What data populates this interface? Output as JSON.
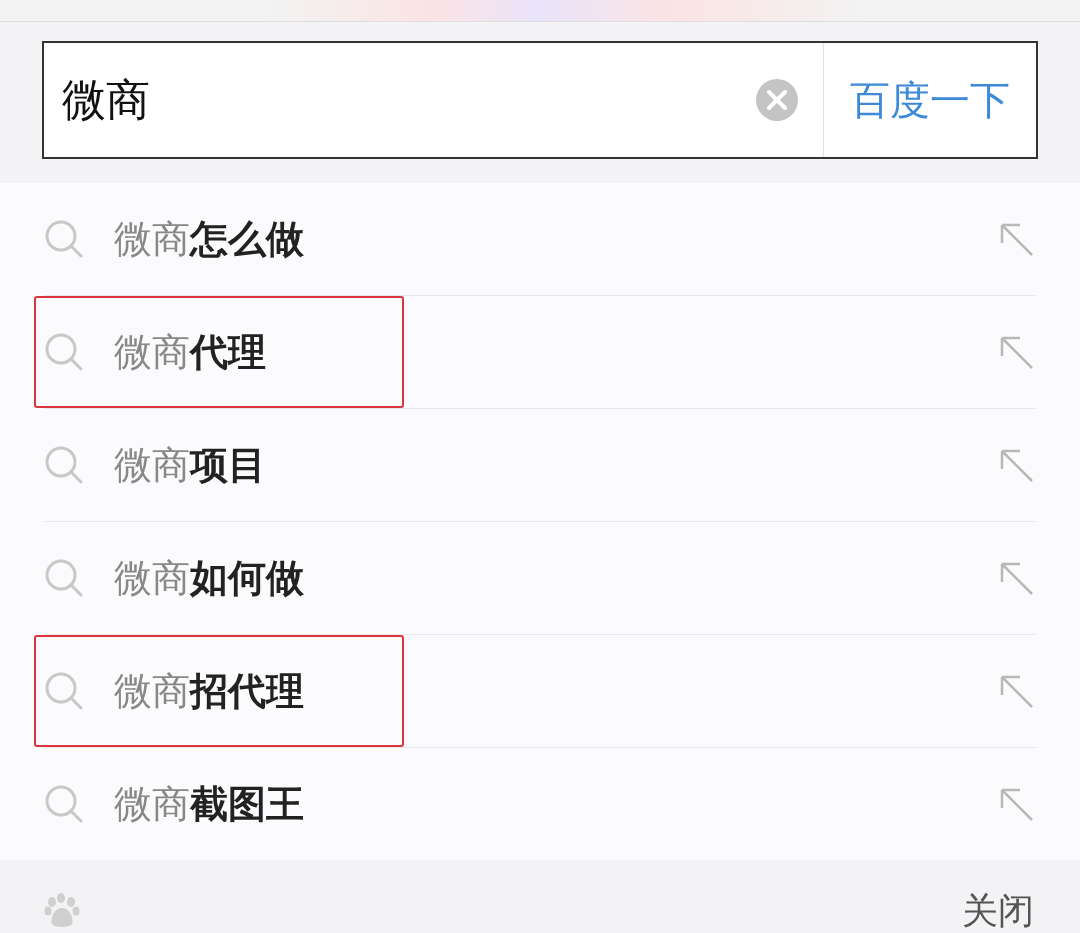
{
  "search": {
    "value": "微商",
    "button": "百度一下"
  },
  "suggestions": [
    {
      "text": "微商**怎么做**",
      "highlighted": false
    },
    {
      "text": "微商**代理**",
      "highlighted": true
    },
    {
      "text": "微商**项目**",
      "highlighted": false
    },
    {
      "text": "微商**如何做**",
      "highlighted": false
    },
    {
      "text": "微商**招代理**",
      "highlighted": true
    },
    {
      "text": "微商**截图王**",
      "highlighted": false
    }
  ],
  "footer": {
    "close": "关闭"
  }
}
